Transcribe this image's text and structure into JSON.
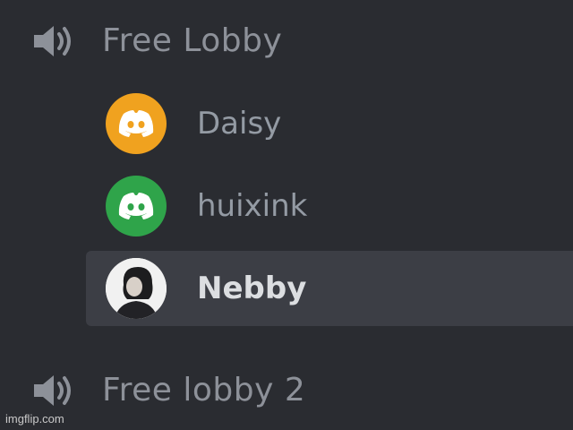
{
  "channels": [
    {
      "name": "Free Lobby",
      "icon": "speaker-icon",
      "members": [
        {
          "name": "Daisy",
          "avatar": "discord-logo-icon",
          "avatar_color": "#f0a21f"
        },
        {
          "name": "huixink",
          "avatar": "discord-logo-icon",
          "avatar_color": "#2fa44a"
        },
        {
          "name": "Nebby",
          "avatar": "user-photo",
          "avatar_color": "#f1f1f1",
          "active": true
        }
      ]
    },
    {
      "name": "Free lobby 2",
      "icon": "speaker-icon",
      "members": []
    }
  ],
  "watermark": "imgflip.com",
  "colors": {
    "background": "#2a2c31",
    "active_row": "#3c3e45",
    "channel_text": "#8d9199",
    "member_text": "#949ba4",
    "active_text": "#dcdee1"
  }
}
